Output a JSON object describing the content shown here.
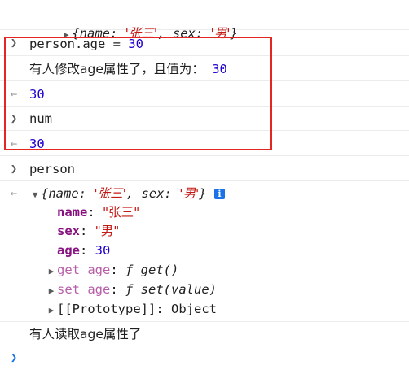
{
  "console": {
    "top_object": {
      "open": "{",
      "k1": "name",
      "v1": "'张三'",
      "k2": "sex",
      "v2": "'男'",
      "close": "}"
    },
    "cmd1": {
      "code": "person.age = ",
      "value": "30"
    },
    "log_set": {
      "text": "有人修改age属性了，且值为：",
      "value": "30"
    },
    "result1": "30",
    "cmd2": "num",
    "result2": "30",
    "cmd3": "person",
    "obj": {
      "open": "{",
      "k1": "name",
      "v1": "'张三'",
      "k2": "sex",
      "v2": "'男'",
      "close": "}",
      "info": "i"
    },
    "props": {
      "name_key": "name",
      "name_val": "\"张三\"",
      "sex_key": "sex",
      "sex_val": "\"男\"",
      "age_key": "age",
      "age_val": "30",
      "getter_key": "get age",
      "getter_val": "ƒ get()",
      "setter_key": "set age",
      "setter_val_prefix": "ƒ set(",
      "setter_param": "value",
      "setter_val_suffix": ")",
      "proto_key": "[[Prototype]]",
      "proto_val": "Object"
    },
    "log_get": "有人读取age属性了"
  },
  "icons": {
    "input_chevron": "chevron-right-icon",
    "output_arrow": "return-arrow-icon",
    "expand_triangle": "triangle-right-icon",
    "collapse_triangle": "triangle-down-icon",
    "info": "info-icon",
    "prompt": "prompt-chevron-icon"
  },
  "colors": {
    "highlight_border": "#e3261f",
    "number": "#1c00cf",
    "string": "#c41a16",
    "property_key": "#881280",
    "accessor_key": "#b85ea9",
    "info_badge": "#1a73e8"
  }
}
